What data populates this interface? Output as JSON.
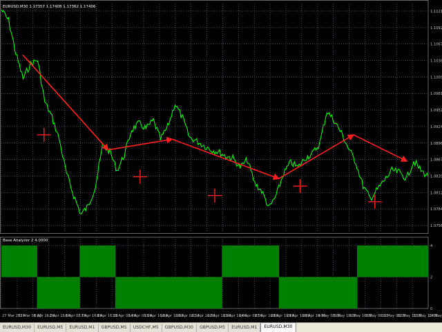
{
  "chart_info": "EURUSD,M30  1.17357 1.17408 1.17362 1.17406",
  "indicator_label": "Base Analyzer 2 4.0000",
  "colors": {
    "price": "#00ff00",
    "annotation": "#ff2020",
    "indicator": "#008000",
    "background": "#000000"
  },
  "price_axis": [
    "1.11210",
    "1.10925",
    "1.10670",
    "1.10380",
    "1.10095",
    "1.09815",
    "1.09525",
    "1.09245",
    "1.08960",
    "1.08675",
    "1.08390",
    "1.08125",
    "1.07845",
    "1.07560"
  ],
  "indicator_axis": [
    "4",
    "2",
    "0"
  ],
  "time_axis": [
    "27 Mar 2020",
    "31 Mar 08:00",
    "1 Apr 16:00",
    "2 Apr 16:00",
    "6 Apr 08:00",
    "7 Apr 16:00",
    "8 Apr 16:00",
    "13 Apr 08:00",
    "14 Apr 08:00",
    "15 Apr 16:00",
    "16 Apr 16:00",
    "20 Apr 08:00",
    "21 Apr 16:00",
    "22 Apr 16:00",
    "23 Apr 16:00",
    "24 Apr 08:00",
    "27 Apr 16:00",
    "28 Apr 16:00",
    "29 Apr 16:00",
    "30 Apr 16:00",
    "4 May 08:00",
    "5 May 16:00",
    "6 May 16:00",
    "8 May 08:00",
    "11 May 08:00",
    "12 May 16:00",
    "13 May 16:00",
    "14 May 16:00"
  ],
  "tabs": [
    "EURUSD,M30",
    "EURUSD,M5",
    "EURUSD,M1",
    "GBPUSD,M5",
    "USDCHF,M5",
    "GBPUSD,M30",
    "GBPUSD,M5",
    "EURUSD,M1",
    "EURUSD,M30"
  ],
  "active_tab": 8,
  "chart_data": {
    "type": "line",
    "price": [
      1.1112,
      1.1095,
      1.1042,
      1.1002,
      1.1025,
      1.1032,
      1.0965,
      1.094,
      1.0905,
      1.085,
      1.0815,
      1.0785,
      1.0798,
      1.083,
      1.0895,
      1.0885,
      1.0855,
      1.088,
      1.092,
      1.093,
      1.0922,
      1.0935,
      1.0905,
      1.0925,
      1.0962,
      1.094,
      1.0908,
      1.0902,
      1.0895,
      1.0888,
      1.0885,
      1.0878,
      1.0875,
      1.086,
      1.0872,
      1.0835,
      1.0822,
      1.0795,
      1.0815,
      1.085,
      1.0868,
      1.086,
      1.0875,
      1.0882,
      1.0898,
      1.095,
      1.0935,
      1.0915,
      1.089,
      1.0868,
      1.083,
      1.081,
      1.0825,
      1.084,
      1.0855,
      1.0852,
      1.0842,
      1.087,
      1.0855,
      1.0845
    ],
    "zigzag_points": [
      [
        1.104,
        2
      ],
      [
        1.0888,
        10
      ],
      [
        1.0905,
        16
      ],
      [
        1.0842,
        26
      ],
      [
        1.0912,
        33
      ],
      [
        1.087,
        38
      ]
    ],
    "cross_markers": [
      [
        1.0912,
        4
      ],
      [
        1.0845,
        13
      ],
      [
        1.0815,
        20
      ],
      [
        1.083,
        28
      ],
      [
        1.0805,
        35
      ]
    ],
    "indicator_series": [
      3,
      3,
      3,
      3,
      3,
      0,
      0,
      0,
      0,
      0,
      0,
      3,
      3,
      3,
      3,
      3,
      0,
      0,
      0,
      0,
      0,
      0,
      0,
      0,
      0,
      0,
      0,
      0,
      0,
      0,
      0,
      3,
      3,
      3,
      3,
      3,
      3,
      3,
      3,
      0,
      0,
      0,
      0,
      0,
      0,
      0,
      0,
      0,
      0,
      0,
      3,
      3,
      3,
      3,
      3,
      3,
      3,
      3,
      3,
      3
    ],
    "indicator_range": [
      0,
      4
    ]
  }
}
